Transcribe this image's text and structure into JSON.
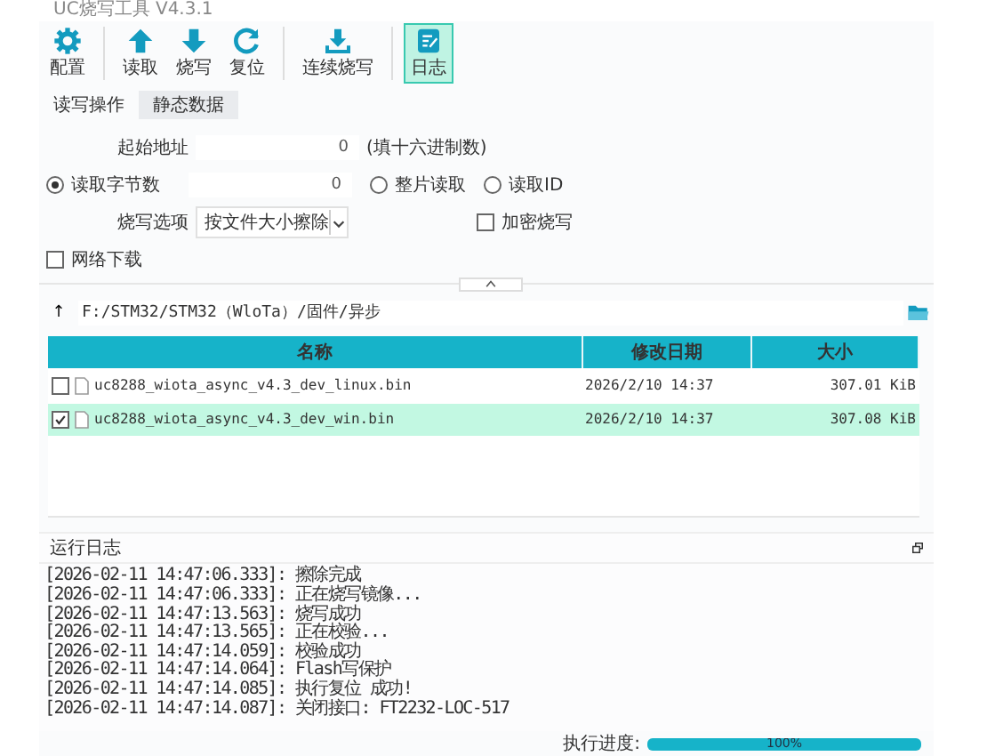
{
  "window": {
    "title": "UC烧写工具 V4.3.1"
  },
  "toolbar": [
    {
      "kind": "gear",
      "label": "配置",
      "active": false
    },
    {
      "kind": "up",
      "label": "读取",
      "active": false
    },
    {
      "kind": "down",
      "label": "烧写",
      "active": false
    },
    {
      "kind": "reset",
      "label": "复位",
      "active": false
    },
    {
      "kind": "download",
      "label": "连续烧写",
      "active": false
    },
    {
      "kind": "notes",
      "label": "日志",
      "active": true
    }
  ],
  "tabs": [
    {
      "label": "读写操作",
      "selected": true
    },
    {
      "label": "静态数据",
      "selected": false
    }
  ],
  "form": {
    "start_address": {
      "label": "起始地址",
      "value": "0",
      "hint": "(填十六进制数)"
    },
    "read_bytes": {
      "value": "0"
    },
    "read_modes": [
      {
        "label": "读取字节数",
        "selected": true
      },
      {
        "label": "整片读取",
        "selected": false
      },
      {
        "label": "读取ID",
        "selected": false
      }
    ],
    "write_option": {
      "label": "烧写选项",
      "value": "按文件大小擦除"
    },
    "encrypt": {
      "label": "加密烧写",
      "checked": false
    },
    "network_download": {
      "label": "网络下载",
      "checked": false
    }
  },
  "path": {
    "up": "↑",
    "value": "F:/STM32/STM32（WloTa）/固件/异步"
  },
  "table": {
    "columns": [
      "名称",
      "修改日期",
      "大小"
    ],
    "rows": [
      {
        "name": "uc8288_wiota_async_v4.3_dev_linux.bin",
        "date": "2026/2/10 14:37",
        "size": "307.01 KiB",
        "checked": false,
        "selected": false
      },
      {
        "name": "uc8288_wiota_async_v4.3_dev_win.bin",
        "date": "2026/2/10 14:37",
        "size": "307.08 KiB",
        "checked": true,
        "selected": true
      }
    ]
  },
  "log": {
    "title": "运行日志",
    "lines": [
      "[2026-02-11 14:47:06.333]: 擦除完成",
      "[2026-02-11 14:47:06.333]: 正在烧写镜像...",
      "[2026-02-11 14:47:13.563]: 烧写成功",
      "[2026-02-11 14:47:13.565]: 正在校验...",
      "[2026-02-11 14:47:14.059]: 校验成功",
      "[2026-02-11 14:47:14.064]: Flash写保护",
      "[2026-02-11 14:47:14.085]: 执行复位 成功!",
      "[2026-02-11 14:47:14.087]: 关闭接口: FT2232-LOC-517"
    ]
  },
  "progress": {
    "label": "执行进度:",
    "level": 1,
    "text": "100%"
  }
}
